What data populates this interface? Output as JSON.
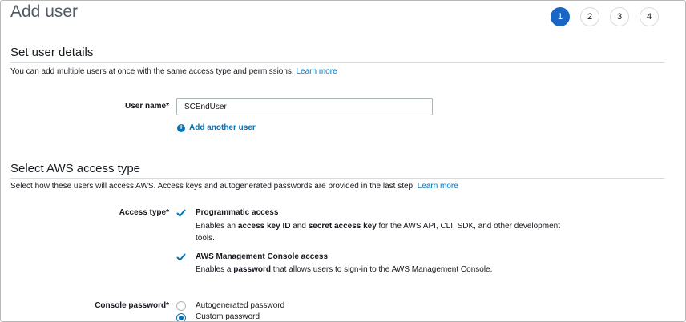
{
  "page": {
    "title": "Add user"
  },
  "steps": [
    {
      "label": "1",
      "active": true
    },
    {
      "label": "2",
      "active": false
    },
    {
      "label": "3",
      "active": false
    },
    {
      "label": "4",
      "active": false
    }
  ],
  "details": {
    "heading": "Set user details",
    "description": "You can add multiple users at once with the same access type and permissions.",
    "learn_more": "Learn more",
    "user_name_label": "User name*",
    "user_name_value": "SCEndUser",
    "add_another": "Add another user"
  },
  "access": {
    "heading": "Select AWS access type",
    "description": "Select how these users will access AWS. Access keys and autogenerated passwords are provided in the last step.",
    "learn_more": "Learn more",
    "access_type_label": "Access type*",
    "programmatic": {
      "title": "Programmatic access",
      "checked": true,
      "desc_1": "Enables an ",
      "desc_b1": "access key ID",
      "desc_2": " and ",
      "desc_b2": "secret access key",
      "desc_3": " for the AWS API, CLI, SDK, and other development tools."
    },
    "console": {
      "title": "AWS Management Console access",
      "checked": true,
      "desc_1": "Enables a ",
      "desc_b1": "password",
      "desc_2": " that allows users to sign-in to the AWS Management Console."
    },
    "password_label": "Console password*",
    "password_options": [
      {
        "label": "Autogenerated password",
        "selected": false
      },
      {
        "label": "Custom password",
        "selected": true
      }
    ]
  },
  "colors": {
    "accent": "#1a66c5",
    "link": "#0073bb"
  },
  "icons": {
    "add": "plus-circle-icon",
    "check": "checkbox-checked-icon"
  }
}
